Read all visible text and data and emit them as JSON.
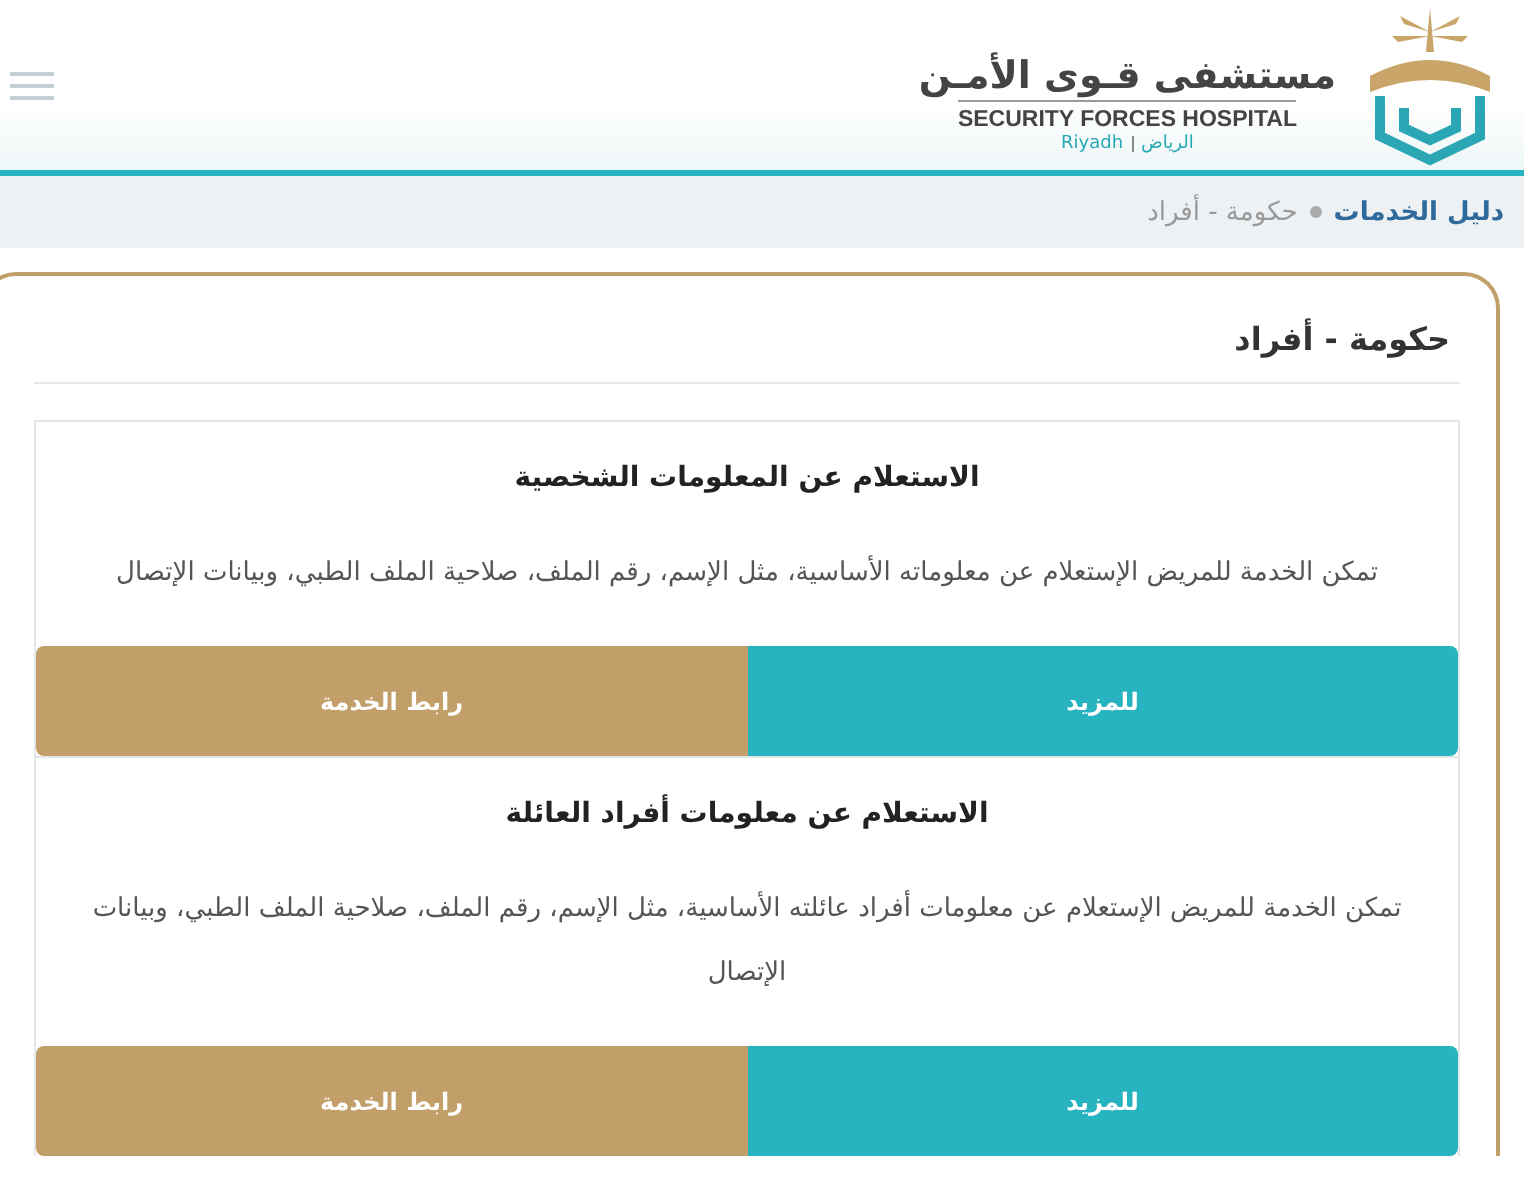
{
  "header": {
    "logo_arabic": "مستشفى قـوى الأمـن",
    "logo_english": "SECURITY FORCES HOSPITAL",
    "logo_city_en": "Riyadh",
    "logo_city_ar": "الرياض"
  },
  "breadcrumb": [
    {
      "label": "دليل الخدمات",
      "kind": "link"
    },
    {
      "label": "حكومة - أفراد",
      "kind": "current"
    }
  ],
  "section": {
    "title": "حكومة - أفراد"
  },
  "services": [
    {
      "title": "الاستعلام عن المعلومات الشخصية",
      "description": "تمكن الخدمة للمريض الإستعلام عن معلوماته الأساسية، مثل الإسم، رقم الملف، صلاحية الملف الطبي، وبيانات الإتصال",
      "buttons": [
        {
          "label": "للمزيد",
          "kind": "more"
        },
        {
          "label": "رابط الخدمة",
          "kind": "link"
        }
      ]
    },
    {
      "title": "الاستعلام عن معلومات أفراد العائلة",
      "description": "تمكن الخدمة للمريض الإستعلام عن معلومات أفراد عائلته الأساسية، مثل الإسم، رقم الملف، صلاحية الملف الطبي، وبيانات الإتصال",
      "buttons": [
        {
          "label": "للمزيد",
          "kind": "more"
        },
        {
          "label": "رابط الخدمة",
          "kind": "link"
        }
      ]
    }
  ]
}
